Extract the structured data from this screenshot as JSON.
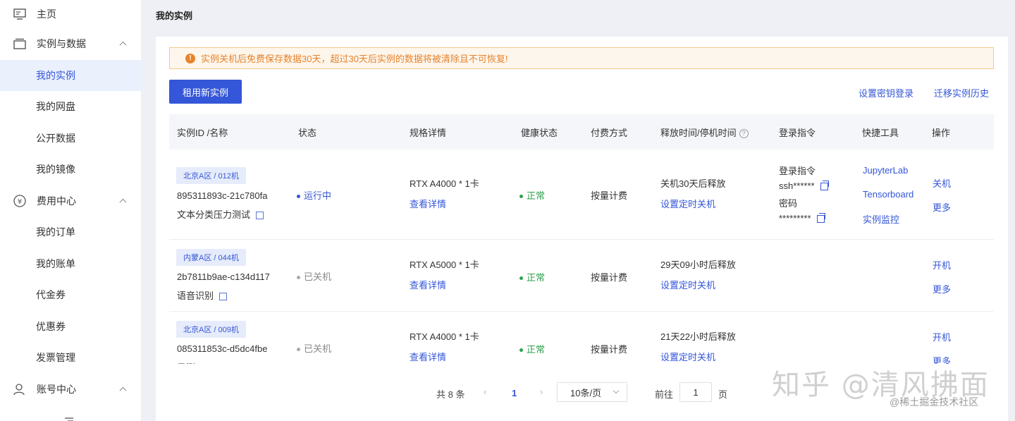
{
  "sidebar": {
    "items": [
      {
        "label": "主页",
        "type": "group",
        "icon": "monitor-icon"
      },
      {
        "label": "实例与数据",
        "type": "group",
        "icon": "instance-icon",
        "expanded": true
      },
      {
        "label": "我的实例",
        "type": "sub",
        "active": true
      },
      {
        "label": "我的网盘",
        "type": "sub"
      },
      {
        "label": "公开数据",
        "type": "sub"
      },
      {
        "label": "我的镜像",
        "type": "sub"
      },
      {
        "label": "费用中心",
        "type": "group",
        "icon": "yen-icon",
        "expanded": true
      },
      {
        "label": "我的订单",
        "type": "sub"
      },
      {
        "label": "我的账单",
        "type": "sub"
      },
      {
        "label": "代金券",
        "type": "sub"
      },
      {
        "label": "优惠券",
        "type": "sub"
      },
      {
        "label": "发票管理",
        "type": "sub"
      },
      {
        "label": "账号中心",
        "type": "group",
        "icon": "user-icon",
        "expanded": true
      }
    ]
  },
  "page": {
    "title": "我的实例",
    "notice": "实例关机后免费保存数据30天，超过30天后实例的数据将被清除且不可恢复!",
    "rent_button": "租用新实例",
    "link_ssh_key": "设置密钥登录",
    "link_migrate": "迁移实例历史"
  },
  "table": {
    "headers": [
      "实例ID /名称",
      "状态",
      "规格详情",
      "健康状态",
      "付费方式",
      "释放时间/停机时间",
      "登录指令",
      "快捷工具",
      "操作"
    ],
    "rows": [
      {
        "region": "北京A区 / 012机",
        "id": "895311893c-21c780fa",
        "name": "文本分类压力测试",
        "status": "运行中",
        "spec": "RTX A4000 * 1卡",
        "spec_link": "查看详情",
        "health": "正常",
        "billing": "按量计费",
        "release": "关机30天后释放",
        "schedule_link": "设置定时关机",
        "login_label": "登录指令",
        "login_cmd": "ssh******",
        "pwd_label": "密码",
        "pwd": "*********",
        "tools": [
          "JupyterLab",
          "Tensorboard",
          "实例监控"
        ],
        "actions": [
          "关机",
          "更多"
        ]
      },
      {
        "region": "内蒙A区 / 044机",
        "id": "2b7811b9ae-c134d117",
        "name": "语音识别",
        "status": "已关机",
        "spec": "RTX A5000 * 1卡",
        "spec_link": "查看详情",
        "health": "正常",
        "billing": "按量计费",
        "release": "29天09小时后释放",
        "schedule_link": "设置定时关机",
        "actions": [
          "开机",
          "更多"
        ]
      },
      {
        "region": "北京A区 / 009机",
        "id": "085311853c-d5dc4fbe",
        "name": "目测",
        "status": "已关机",
        "spec": "RTX A4000 * 1卡",
        "spec_link": "查看详情",
        "health": "正常",
        "billing": "按量计费",
        "release": "21天22小时后释放",
        "schedule_link": "设置定时关机",
        "actions": [
          "开机",
          "更多"
        ]
      }
    ]
  },
  "pagination": {
    "total": "共 8 条",
    "current": "1",
    "page_size": "10条/页",
    "goto_label": "前往",
    "goto_value": "1",
    "page_unit": "页"
  },
  "watermark": {
    "main": "知乎 @清风拂面",
    "sub": "@稀土掘金技术社区"
  },
  "colors": {
    "accent": "#3456d8",
    "warning": "#e6832d",
    "success": "#2fa14f"
  }
}
